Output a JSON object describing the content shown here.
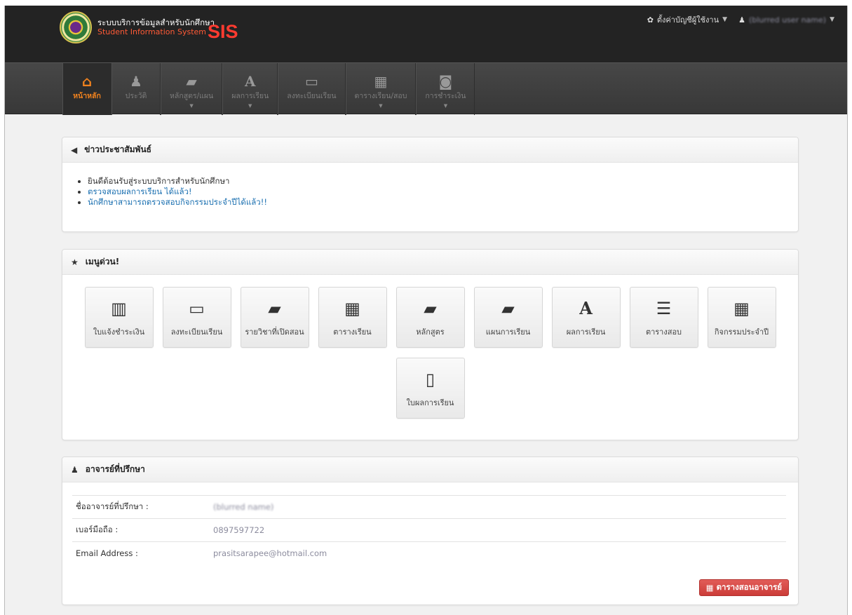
{
  "header": {
    "brand_thai": "ระบบบริการข้อมูลสำหรับนักศึกษา",
    "brand_english": "Student Information System",
    "brand_sis": "SIS",
    "settings_menu": {
      "icon": "gear-icon",
      "label": "ตั้งค่าบัญชีผู้ใช้งาน"
    },
    "user_menu": {
      "icon": "user-icon",
      "label": "(blurred user name)"
    }
  },
  "nav": {
    "items": [
      {
        "icon": "home-icon",
        "label": "หน้าหลัก",
        "active": true,
        "dropdown": false
      },
      {
        "icon": "user-icon",
        "label": "ประวัติ",
        "active": false,
        "dropdown": false
      },
      {
        "icon": "book-icon",
        "label": "หลักสูตร/แผน",
        "active": false,
        "dropdown": true
      },
      {
        "icon": "font-a-icon",
        "label": "ผลการเรียน",
        "active": false,
        "dropdown": true
      },
      {
        "icon": "monitor-icon",
        "label": "ลงทะเบียนเรียน",
        "active": false,
        "dropdown": false
      },
      {
        "icon": "calendar-icon",
        "label": "ตารางเรียน/สอบ",
        "active": false,
        "dropdown": true
      },
      {
        "icon": "money-icon",
        "label": "การชำระเงิน",
        "active": false,
        "dropdown": true
      }
    ]
  },
  "news": {
    "icon": "megaphone-icon",
    "title": "ข่าวประชาสัมพันธ์",
    "items": [
      {
        "text": "ยินดีต้อนรับสู่ระบบบริการสำหรับนักศึกษา",
        "link": false
      },
      {
        "text": "ตรวจสอบผลการเรียน ได้แล้ว!",
        "link": true
      },
      {
        "text": "นักศึกษาสามารถตรวจสอบกิจกรรมประจำปีได้แล้ว!!",
        "link": true
      }
    ]
  },
  "quick_menu": {
    "icon": "star-icon",
    "title": "เมนูด่วน!",
    "items": [
      {
        "icon": "barcode-icon",
        "label": "ใบแจ้งชำระเงิน"
      },
      {
        "icon": "monitor-icon",
        "label": "ลงทะเบียนเรียน"
      },
      {
        "icon": "book-icon",
        "label": "รายวิชาที่เปิดสอน"
      },
      {
        "icon": "calendar-icon",
        "label": "ตารางเรียน"
      },
      {
        "icon": "book-icon",
        "label": "หลักสูตร"
      },
      {
        "icon": "book-icon",
        "label": "แผนการเรียน"
      },
      {
        "icon": "font-a-icon",
        "label": "ผลการเรียน"
      },
      {
        "icon": "list-icon",
        "label": "ตารางสอบ"
      },
      {
        "icon": "table-icon",
        "label": "กิจกรรมประจำปี"
      },
      {
        "icon": "file-icon",
        "label": "ใบผลการเรียน"
      }
    ]
  },
  "advisor": {
    "icon": "user-icon",
    "title": "อาจารย์ที่ปรึกษา",
    "rows": [
      {
        "label": "ชื่ออาจารย์ที่ปรึกษา :",
        "value": "(blurred name)"
      },
      {
        "label": "เบอร์มือถือ :",
        "value": "0897597722"
      },
      {
        "label": "Email Address :",
        "value": "prasitsarapee@hotmail.com"
      }
    ],
    "schedule_button": {
      "icon": "table-icon",
      "label": "ตารางสอนอาจารย์"
    }
  },
  "colors": {
    "accent_orange": "#f0821e",
    "brand_red": "#ff3b30",
    "link_blue": "#1a6fb0",
    "button_red": "#d9534f"
  }
}
